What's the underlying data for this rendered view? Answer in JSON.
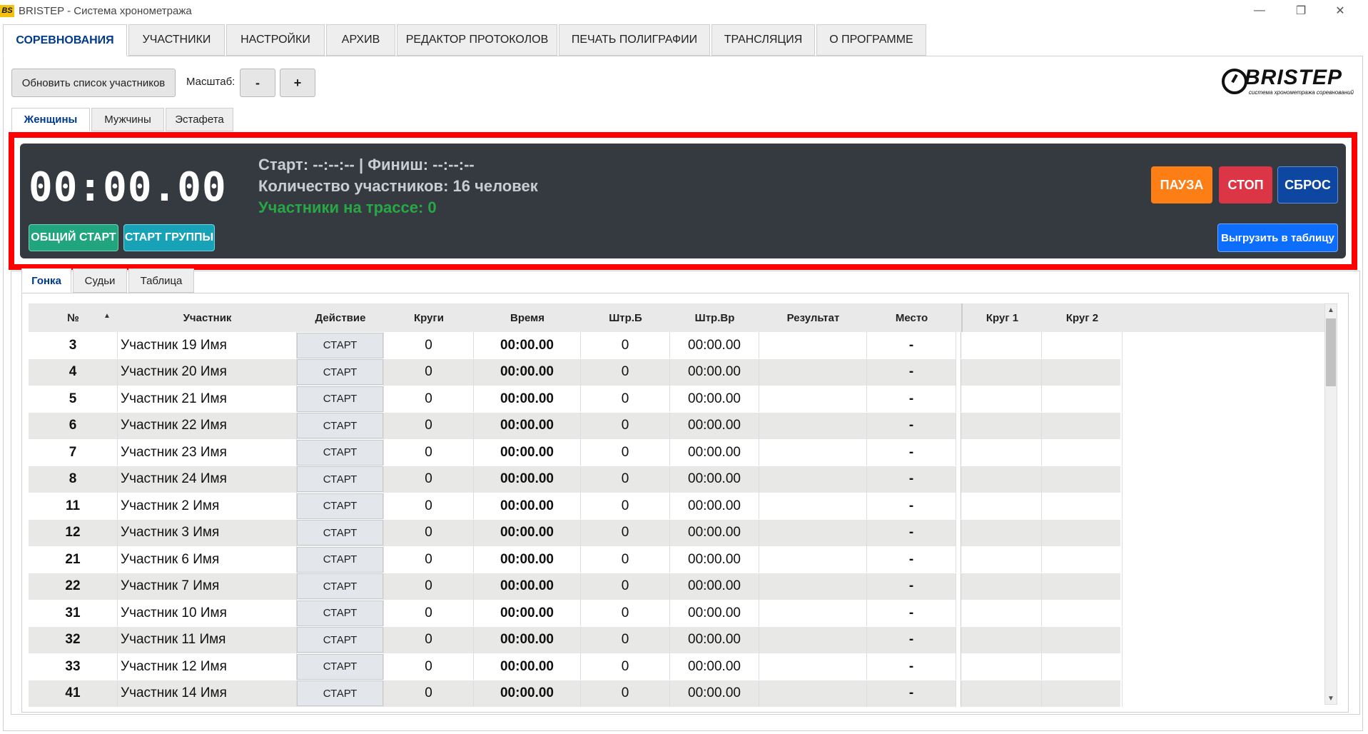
{
  "window": {
    "icon_text": "BS",
    "title": "BRISTEP - Система хронометража",
    "min_glyph": "—",
    "max_glyph": "❐",
    "close_glyph": "✕"
  },
  "main_tabs": [
    {
      "label": "СОРЕВНОВАНИЯ",
      "active": true
    },
    {
      "label": "УЧАСТНИКИ",
      "active": false
    },
    {
      "label": "НАСТРОЙКИ",
      "active": false
    },
    {
      "label": "АРХИВ",
      "active": false
    },
    {
      "label": "РЕДАКТОР ПРОТОКОЛОВ",
      "active": false
    },
    {
      "label": "ПЕЧАТЬ ПОЛИГРАФИИ",
      "active": false
    },
    {
      "label": "ТРАНСЛЯЦИЯ",
      "active": false
    },
    {
      "label": "О ПРОГРАММЕ",
      "active": false
    }
  ],
  "toolbar": {
    "refresh_label": "Обновить список участников",
    "scale_label": "Масштаб:",
    "scale_minus": "-",
    "scale_plus": "+"
  },
  "logo": {
    "text": "BRISTEP",
    "subtitle": "система хронометража соревнований"
  },
  "category_tabs": [
    {
      "label": "Женщины",
      "active": true
    },
    {
      "label": "Мужчины",
      "active": false
    },
    {
      "label": "Эстафета",
      "active": false
    }
  ],
  "timer": {
    "clock": "00:00.00",
    "start_finish": "Старт: --:--:-- | Финиш: --:--:--",
    "participants_count": "Количество участников: 16 человек",
    "on_track": "Участники на трассе: 0",
    "common_start_label": "ОБЩИЙ СТАРТ",
    "group_start_label": "СТАРТ ГРУППЫ",
    "pause_label": "ПАУЗА",
    "stop_label": "СТОП",
    "reset_label": "СБРОС",
    "export_label": "Выгрузить в таблицу",
    "colors": {
      "panel_bg": "#343a40",
      "common_start": "#20a57e",
      "group_start": "#17a2b8",
      "pause": "#fd7e14",
      "stop": "#dc3545",
      "reset": "#0d47a1",
      "export": "#0d6efd",
      "on_track_text": "#28a745",
      "highlight_border": "#ff0000"
    }
  },
  "race_tabs": [
    {
      "label": "Гонка",
      "active": true
    },
    {
      "label": "Судьи",
      "active": false
    },
    {
      "label": "Таблица",
      "active": false
    }
  ],
  "table": {
    "sort_indicator": "▲",
    "columns": {
      "num": "№",
      "participant": "Участник",
      "action": "Действие",
      "laps": "Круги",
      "time": "Время",
      "pen_b": "Штр.Б",
      "pen_vr": "Штр.Вр",
      "result": "Результат",
      "place": "Место",
      "lap1": "Круг 1",
      "lap2": "Круг 2"
    },
    "rows": [
      {
        "num": "3",
        "name": "Участник 19 Имя",
        "action": "СТАРТ",
        "laps": "0",
        "time": "00:00.00",
        "pen_b": "0",
        "pen_vr": "00:00.00",
        "result": "",
        "place": "-"
      },
      {
        "num": "4",
        "name": "Участник 20 Имя",
        "action": "СТАРТ",
        "laps": "0",
        "time": "00:00.00",
        "pen_b": "0",
        "pen_vr": "00:00.00",
        "result": "",
        "place": "-"
      },
      {
        "num": "5",
        "name": "Участник 21 Имя",
        "action": "СТАРТ",
        "laps": "0",
        "time": "00:00.00",
        "pen_b": "0",
        "pen_vr": "00:00.00",
        "result": "",
        "place": "-"
      },
      {
        "num": "6",
        "name": "Участник 22 Имя",
        "action": "СТАРТ",
        "laps": "0",
        "time": "00:00.00",
        "pen_b": "0",
        "pen_vr": "00:00.00",
        "result": "",
        "place": "-"
      },
      {
        "num": "7",
        "name": "Участник 23 Имя",
        "action": "СТАРТ",
        "laps": "0",
        "time": "00:00.00",
        "pen_b": "0",
        "pen_vr": "00:00.00",
        "result": "",
        "place": "-"
      },
      {
        "num": "8",
        "name": "Участник 24 Имя",
        "action": "СТАРТ",
        "laps": "0",
        "time": "00:00.00",
        "pen_b": "0",
        "pen_vr": "00:00.00",
        "result": "",
        "place": "-"
      },
      {
        "num": "11",
        "name": "Участник 2 Имя",
        "action": "СТАРТ",
        "laps": "0",
        "time": "00:00.00",
        "pen_b": "0",
        "pen_vr": "00:00.00",
        "result": "",
        "place": "-"
      },
      {
        "num": "12",
        "name": "Участник 3 Имя",
        "action": "СТАРТ",
        "laps": "0",
        "time": "00:00.00",
        "pen_b": "0",
        "pen_vr": "00:00.00",
        "result": "",
        "place": "-"
      },
      {
        "num": "21",
        "name": "Участник 6 Имя",
        "action": "СТАРТ",
        "laps": "0",
        "time": "00:00.00",
        "pen_b": "0",
        "pen_vr": "00:00.00",
        "result": "",
        "place": "-"
      },
      {
        "num": "22",
        "name": "Участник 7 Имя",
        "action": "СТАРТ",
        "laps": "0",
        "time": "00:00.00",
        "pen_b": "0",
        "pen_vr": "00:00.00",
        "result": "",
        "place": "-"
      },
      {
        "num": "31",
        "name": "Участник 10 Имя",
        "action": "СТАРТ",
        "laps": "0",
        "time": "00:00.00",
        "pen_b": "0",
        "pen_vr": "00:00.00",
        "result": "",
        "place": "-"
      },
      {
        "num": "32",
        "name": "Участник 11 Имя",
        "action": "СТАРТ",
        "laps": "0",
        "time": "00:00.00",
        "pen_b": "0",
        "pen_vr": "00:00.00",
        "result": "",
        "place": "-"
      },
      {
        "num": "33",
        "name": "Участник 12 Имя",
        "action": "СТАРТ",
        "laps": "0",
        "time": "00:00.00",
        "pen_b": "0",
        "pen_vr": "00:00.00",
        "result": "",
        "place": "-"
      },
      {
        "num": "41",
        "name": "Участник 14 Имя",
        "action": "СТАРТ",
        "laps": "0",
        "time": "00:00.00",
        "pen_b": "0",
        "pen_vr": "00:00.00",
        "result": "",
        "place": "-"
      }
    ],
    "scroll_up": "▲",
    "scroll_down": "▼"
  }
}
